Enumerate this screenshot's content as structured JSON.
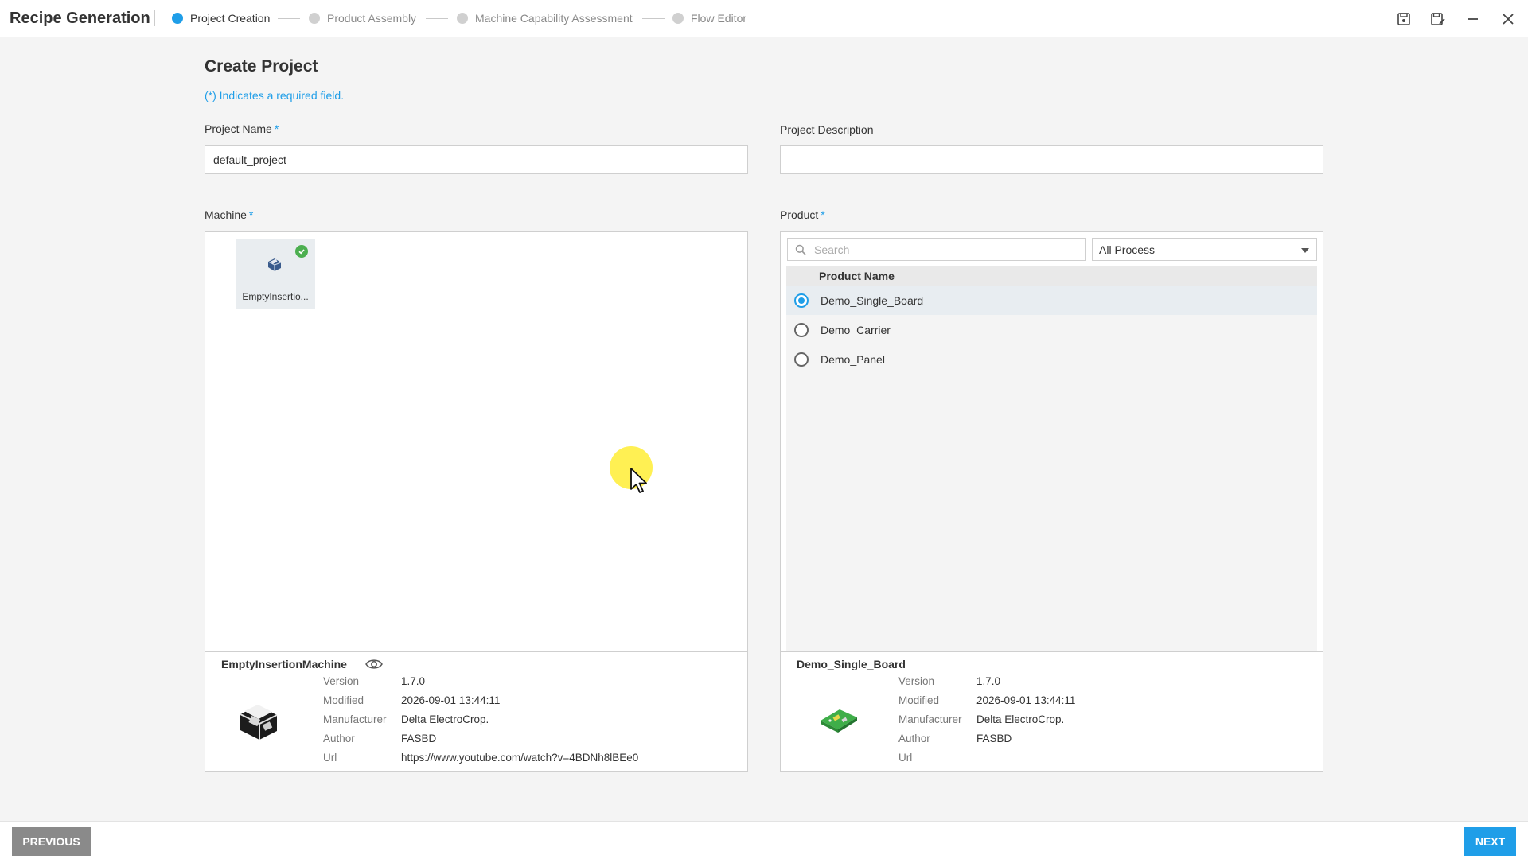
{
  "app": {
    "title": "Recipe Generation"
  },
  "steps": [
    {
      "label": "Project Creation",
      "active": true
    },
    {
      "label": "Product Assembly",
      "active": false
    },
    {
      "label": "Machine Capability Assessment",
      "active": false
    },
    {
      "label": "Flow Editor",
      "active": false
    }
  ],
  "header_icons": [
    "save-icon",
    "save-as-icon",
    "minimize-icon",
    "close-icon"
  ],
  "page": {
    "title": "Create Project",
    "required_note": "(*) Indicates a required field."
  },
  "fields": {
    "project_name": {
      "label": "Project Name",
      "required_mark": "*",
      "value": "default_project"
    },
    "project_description": {
      "label": "Project Description",
      "value": ""
    }
  },
  "machine": {
    "label": "Machine",
    "required_mark": "*",
    "tiles": [
      {
        "label": "EmptyInsertio...",
        "selected": true
      }
    ],
    "details": {
      "name": "EmptyInsertionMachine",
      "rows": [
        {
          "key": "Version",
          "value": "1.7.0"
        },
        {
          "key": "Modified",
          "value": "2026-09-01 13:44:11"
        },
        {
          "key": "Manufacturer",
          "value": "Delta ElectroCrop."
        },
        {
          "key": "Author",
          "value": "FASBD"
        },
        {
          "key": "Url",
          "value": "https://www.youtube.com/watch?v=4BDNh8lBEe0"
        }
      ]
    }
  },
  "product": {
    "label": "Product",
    "required_mark": "*",
    "search_placeholder": "Search",
    "process_filter": "All Process",
    "column_header": "Product Name",
    "items": [
      {
        "name": "Demo_Single_Board",
        "selected": true
      },
      {
        "name": "Demo_Carrier",
        "selected": false
      },
      {
        "name": "Demo_Panel",
        "selected": false
      }
    ],
    "details": {
      "name": "Demo_Single_Board",
      "rows": [
        {
          "key": "Version",
          "value": "1.7.0"
        },
        {
          "key": "Modified",
          "value": "2026-09-01 13:44:11"
        },
        {
          "key": "Manufacturer",
          "value": "Delta ElectroCrop."
        },
        {
          "key": "Author",
          "value": "FASBD"
        },
        {
          "key": "Url",
          "value": ""
        }
      ]
    }
  },
  "footer": {
    "previous_label": "PREVIOUS",
    "next_label": "NEXT"
  },
  "colors": {
    "accent": "#1f9ee8",
    "success": "#4caf50",
    "previous_button": "#8a8a8a"
  }
}
